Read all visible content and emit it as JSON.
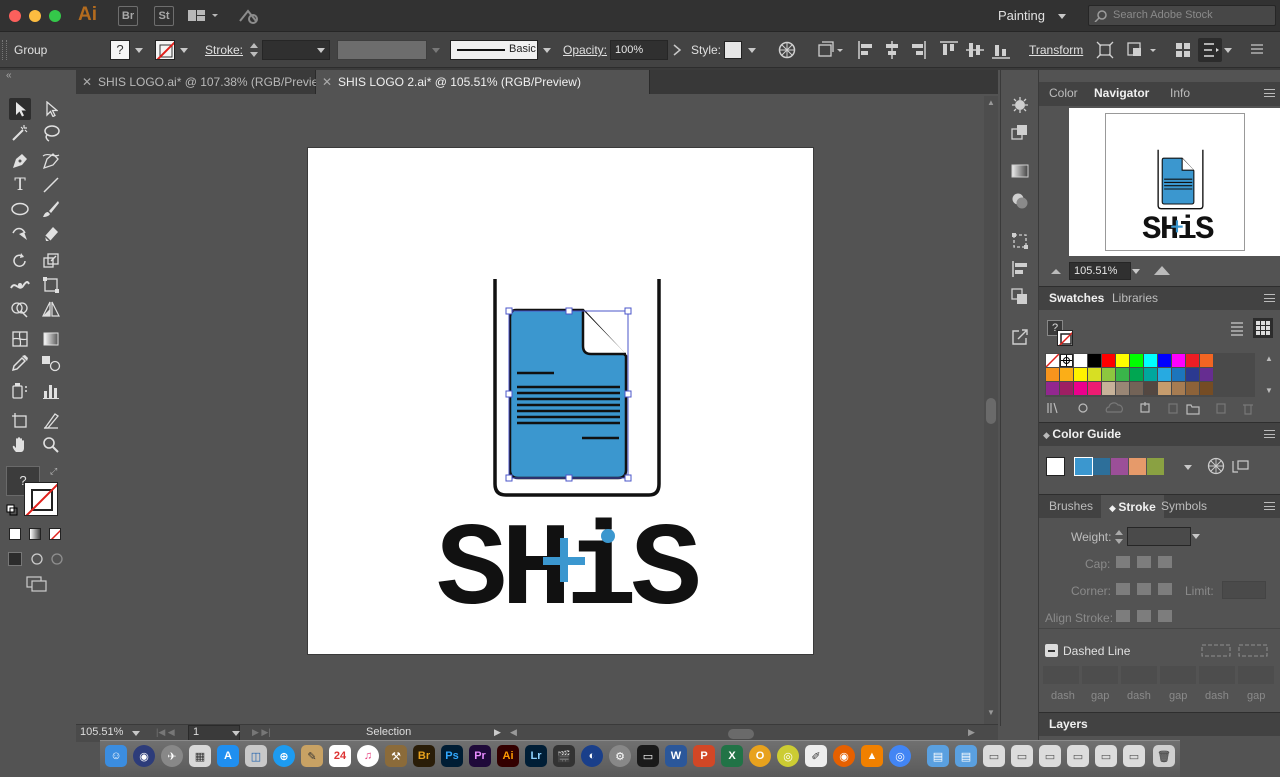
{
  "app": {
    "logo": "Ai",
    "bridge_label": "Br",
    "stock_label": "St",
    "workspace": "Painting",
    "search_placeholder": "Search Adobe Stock"
  },
  "control_bar": {
    "selection_type": "Group",
    "stroke_label": "Stroke:",
    "brush_name": "Basic",
    "opacity_label": "Opacity:",
    "opacity_value": "100%",
    "style_label": "Style:",
    "transform_label": "Transform"
  },
  "tabs": [
    {
      "label": "SHIS LOGO.ai* @ 107.38% (RGB/Preview)",
      "active": false
    },
    {
      "label": "SHIS LOGO 2.ai* @ 105.51% (RGB/Preview)",
      "active": true
    }
  ],
  "status": {
    "zoom": "105.51%",
    "artboard_number": "1",
    "tool_name": "Selection"
  },
  "artwork": {
    "logo_text": "SHiS",
    "fill_color": "#3b97cf",
    "ink_color": "#111111"
  },
  "panels": {
    "top_tabs": [
      "Color",
      "Navigator",
      "Info"
    ],
    "navigator_zoom": "105.51%",
    "swatches_tabs": [
      "Swatches",
      "Libraries"
    ],
    "color_guide_title": "Color Guide",
    "stroke_tabs": [
      "Brushes",
      "Stroke",
      "Symbols"
    ],
    "weight_label": "Weight:",
    "cap_label": "Cap:",
    "corner_label": "Corner:",
    "limit_label": "Limit:",
    "align_stroke_label": "Align Stroke:",
    "dashed_line_label": "Dashed Line",
    "dash_labels": [
      "dash",
      "gap",
      "dash",
      "gap",
      "dash",
      "gap"
    ],
    "layers_title": "Layers"
  },
  "swatch_colors": [
    "#ffffff",
    "#000000",
    "#ff0000",
    "#ffff00",
    "#00ff00",
    "#00ffff",
    "#0000ff",
    "#ff00ff",
    "#ee1d24",
    "#f26522",
    "#f7941d",
    "#fbae17",
    "#fff200",
    "#d7df23",
    "#8dc63f",
    "#39b54a",
    "#00a651",
    "#00a79d",
    "#27aae1",
    "#1c75bc",
    "#2b3990",
    "#662d91",
    "#92278f",
    "#9e1f63",
    "#ec008c",
    "#ed1c72",
    "#c7b299",
    "#998675",
    "#736357",
    "#534741",
    "#c69c6d",
    "#a67c52",
    "#8c6239",
    "#754c24",
    "#603913",
    "#3c2415"
  ],
  "color_guide_swatches": [
    "#3b97cf",
    "#2d6f9a",
    "#9b4f98",
    "#e69a6a",
    "#8aa142"
  ],
  "icons": [
    "arrow-icon",
    "direct-select-icon",
    "magic-wand-icon",
    "lasso-icon",
    "pen-icon",
    "curvature-icon",
    "type-icon",
    "line-icon",
    "ellipse-icon",
    "paintbrush-icon",
    "shaper-icon",
    "eraser-icon",
    "rotate-icon",
    "scale-icon",
    "width-icon",
    "free-transform-icon",
    "shape-builder-icon",
    "perspective-icon",
    "mesh-icon",
    "gradient-icon",
    "eyedropper-icon",
    "blend-icon",
    "symbol-sprayer-icon",
    "graph-icon",
    "artboard-icon",
    "slice-icon",
    "hand-icon",
    "zoom-icon"
  ]
}
